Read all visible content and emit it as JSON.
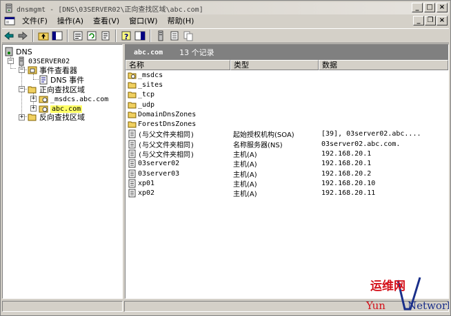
{
  "window": {
    "title": "dnsmgmt - [DNS\\03SERVER02\\正向查找区域\\abc.com]"
  },
  "menu": {
    "items": [
      "文件(F)",
      "操作(A)",
      "查看(V)",
      "窗口(W)",
      "帮助(H)"
    ]
  },
  "tree": {
    "root": "DNS",
    "server": "03SERVER02",
    "event_viewer": "事件查看器",
    "dns_events": "DNS 事件",
    "forward_zones": "正向查找区域",
    "msdcs_zone": "_msdcs.abc.com",
    "abc_zone": "abc.com",
    "reverse_zones": "反向查找区域"
  },
  "list": {
    "zone_name": "abc.com",
    "record_count": "13 个记录",
    "headers": [
      "名称",
      "类型",
      "数据"
    ],
    "rows": [
      {
        "name": "_msdcs",
        "type": "",
        "data": "",
        "icon": "folder-special"
      },
      {
        "name": "_sites",
        "type": "",
        "data": "",
        "icon": "folder"
      },
      {
        "name": "_tcp",
        "type": "",
        "data": "",
        "icon": "folder"
      },
      {
        "name": "_udp",
        "type": "",
        "data": "",
        "icon": "folder"
      },
      {
        "name": "DomainDnsZones",
        "type": "",
        "data": "",
        "icon": "folder"
      },
      {
        "name": "ForestDnsZones",
        "type": "",
        "data": "",
        "icon": "folder"
      },
      {
        "name": "(与父文件夹相同)",
        "type": "起始授权机构(SOA)",
        "data": "[39], 03server02.abc....",
        "icon": "record"
      },
      {
        "name": "(与父文件夹相同)",
        "type": "名称服务器(NS)",
        "data": "03server02.abc.com.",
        "icon": "record"
      },
      {
        "name": "(与父文件夹相同)",
        "type": "主机(A)",
        "data": "192.168.20.1",
        "icon": "record"
      },
      {
        "name": "03server02",
        "type": "主机(A)",
        "data": "192.168.20.1",
        "icon": "record"
      },
      {
        "name": "03server03",
        "type": "主机(A)",
        "data": "192.168.20.2",
        "icon": "record"
      },
      {
        "name": "xp01",
        "type": "主机(A)",
        "data": "192.168.20.10",
        "icon": "record"
      },
      {
        "name": "xp02",
        "type": "主机(A)",
        "data": "192.168.20.11",
        "icon": "record"
      }
    ]
  },
  "watermark": {
    "line1": "运维网",
    "line2_left": "Yun",
    "line2_right": "Network"
  },
  "colors": {
    "selection_highlight": "#ffff66",
    "zone_bar": "#808080",
    "watermark_red": "#d4101a",
    "watermark_blue": "#1a2f8a"
  }
}
